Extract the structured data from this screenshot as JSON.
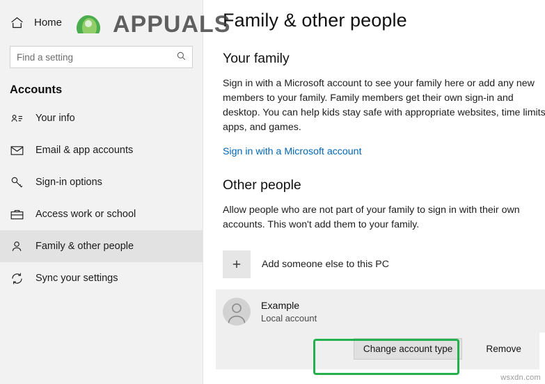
{
  "window": {
    "home_label": "Home",
    "watermark_main": "APPUALS",
    "watermark_corner": "wsxdn.com"
  },
  "sidebar": {
    "search": {
      "placeholder": "Find a setting",
      "value": "",
      "icon": "search-icon"
    },
    "section_title": "Accounts",
    "items": [
      {
        "label": "Your info",
        "icon": "contact-card-icon",
        "selected": false
      },
      {
        "label": "Email & app accounts",
        "icon": "envelope-icon",
        "selected": false
      },
      {
        "label": "Sign-in options",
        "icon": "key-icon",
        "selected": false
      },
      {
        "label": "Access work or school",
        "icon": "briefcase-icon",
        "selected": false
      },
      {
        "label": "Family & other people",
        "icon": "people-icon",
        "selected": true
      },
      {
        "label": "Sync your settings",
        "icon": "sync-icon",
        "selected": false
      }
    ]
  },
  "main": {
    "title": "Family & other people",
    "family": {
      "heading": "Your family",
      "body": "Sign in with a Microsoft account to see your family here or add any new members to your family. Family members get their own sign-in and desktop. You can help kids stay safe with appropriate websites, time limits, apps, and games.",
      "link": "Sign in with a Microsoft account"
    },
    "other_people": {
      "heading": "Other people",
      "body": "Allow people who are not part of your family to sign in with their own accounts. This won't add them to your family.",
      "add_label": "Add someone else to this PC",
      "add_icon": "plus-icon",
      "account": {
        "name": "Example",
        "type": "Local account",
        "avatar_icon": "user-avatar-icon"
      },
      "buttons": {
        "change_type": "Change account type",
        "remove": "Remove"
      }
    }
  },
  "colors": {
    "accent_link": "#0067b8",
    "highlight": "#22b14c",
    "sidebar_bg": "#f2f2f2",
    "card_bg": "#efefef"
  }
}
